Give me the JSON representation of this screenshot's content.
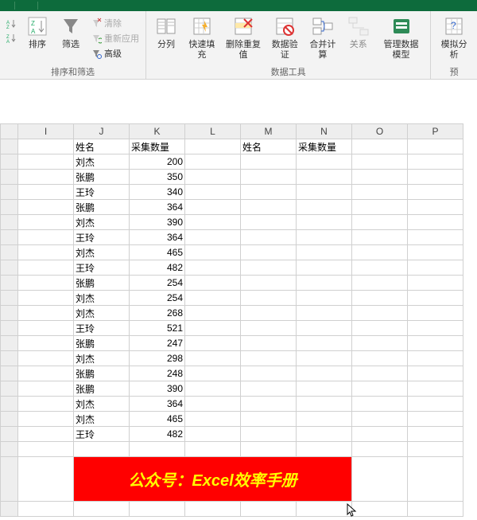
{
  "titlebar": {
    "t1": "",
    "t2": "",
    "t3": ""
  },
  "ribbon": {
    "group_sort_filter_label": "排序和筛选",
    "group_data_tools_label": "数据工具",
    "group_forecast_label": "预",
    "sort": "排序",
    "az": "A→Z",
    "za": "Z→A",
    "filter": "筛选",
    "clear": "清除",
    "reapply": "重新应用",
    "advanced": "高级",
    "text_to_cols": "分列",
    "flash_fill": "快速填充",
    "remove_dup": "删除重复值",
    "data_valid": "数据验证",
    "consolidate": "合并计算",
    "relationships": "关系",
    "data_model": "管理数据模型",
    "what_if": "模拟分析"
  },
  "columns": [
    "I",
    "J",
    "K",
    "L",
    "M",
    "N",
    "O",
    "P"
  ],
  "headers": {
    "name": "姓名",
    "qty": "采集数量"
  },
  "rows": [
    {
      "name": "刘杰",
      "qty": 200
    },
    {
      "name": "张鹏",
      "qty": 350
    },
    {
      "name": "王玲",
      "qty": 340
    },
    {
      "name": "张鹏",
      "qty": 364
    },
    {
      "name": "刘杰",
      "qty": 390
    },
    {
      "name": "王玲",
      "qty": 364
    },
    {
      "name": "刘杰",
      "qty": 465
    },
    {
      "name": "王玲",
      "qty": 482
    },
    {
      "name": "张鹏",
      "qty": 254
    },
    {
      "name": "刘杰",
      "qty": 254
    },
    {
      "name": "刘杰",
      "qty": 268
    },
    {
      "name": "王玲",
      "qty": 521
    },
    {
      "name": "张鹏",
      "qty": 247
    },
    {
      "name": "刘杰",
      "qty": 298
    },
    {
      "name": "张鹏",
      "qty": 248
    },
    {
      "name": "张鹏",
      "qty": 390
    },
    {
      "name": "刘杰",
      "qty": 364
    },
    {
      "name": "刘杰",
      "qty": 465
    },
    {
      "name": "王玲",
      "qty": 482
    }
  ],
  "banner": "公众号：Excel效率手册"
}
